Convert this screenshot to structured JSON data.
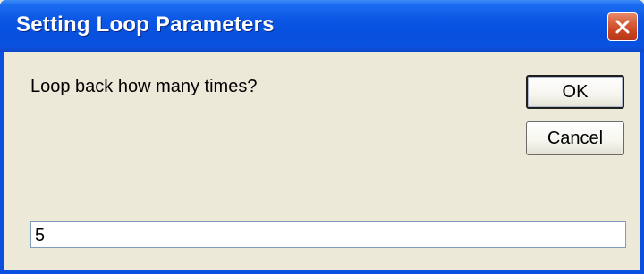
{
  "dialog": {
    "title": "Setting Loop Parameters",
    "prompt": "Loop back how many times?",
    "ok_label": "OK",
    "cancel_label": "Cancel",
    "input_value": "5"
  },
  "icons": {
    "close": "close-icon"
  },
  "colors": {
    "titlebar": "#0a55e3",
    "close_button": "#d9603c",
    "client_background": "#ece9d8"
  }
}
